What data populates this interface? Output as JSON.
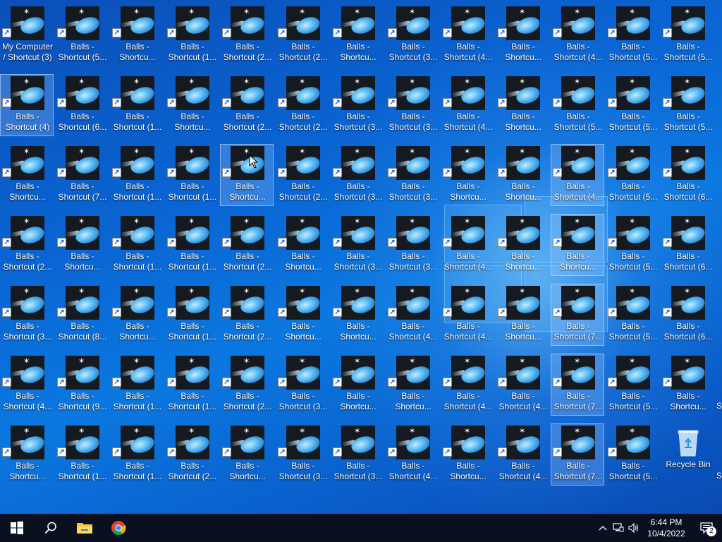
{
  "desktop": {
    "icons": [
      [
        "My Computer / Shortcut (3)",
        "Balls -\nShortcut (5...",
        "Balls -\nShortcu...",
        "Balls -\nShortcut (1...",
        "Balls -\nShortcut (2...",
        "Balls -\nShortcut (2...",
        "Balls -\nShortcu...",
        "Balls -\nShortcut (3...",
        "Balls -\nShortcut (4...",
        "Balls -\nShortcu...",
        "Balls -\nShortcut (4...",
        "Balls -\nShortcut (5...",
        "Balls -\nShortcut (5..."
      ],
      [
        "Balls -\nShortcut (4)",
        "Balls -\nShortcut (6...",
        "Balls -\nShortcut (1...",
        "Balls -\nShortcu...",
        "Balls -\nShortcut (2...",
        "Balls -\nShortcut (2...",
        "Balls -\nShortcut (3...",
        "Balls -\nShortcut (3...",
        "Balls -\nShortcut (4...",
        "Balls -\nShortcu...",
        "Balls -\nShortcut (5...",
        "Balls -\nShortcut (5...",
        "Balls -\nShortcut (5..."
      ],
      [
        "Balls -\nShortcu...",
        "Balls -\nShortcut (7...",
        "Balls -\nShortcut (1...",
        "Balls -\nShortcut (1...",
        "Balls -\nShortcu...",
        "Balls -\nShortcut (2...",
        "Balls -\nShortcut (3...",
        "Balls -\nShortcut (3...",
        "Balls -\nShortcu...",
        "Balls -\nShortcu...",
        "Balls -\nShortcut (4...",
        "Balls -\nShortcut (5...",
        "Balls -\nShortcut (6..."
      ],
      [
        "Balls -\nShortcut (2...",
        "Balls -\nShortcu...",
        "Balls -\nShortcut (1...",
        "Balls -\nShortcut (1...",
        "Balls -\nShortcut (2...",
        "Balls -\nShortcu...",
        "Balls -\nShortcut (3...",
        "Balls -\nShortcut (3...",
        "Balls -\nShortcut (4...",
        "Balls -\nShortcu...",
        "Balls -\nShortcu...",
        "Balls -\nShortcut (5...",
        "Balls -\nShortcut (6..."
      ],
      [
        "Balls -\nShortcut (3...",
        "Balls -\nShortcut (8...",
        "Balls -\nShortcu...",
        "Balls -\nShortcut (1...",
        "Balls -\nShortcut (2...",
        "Balls -\nShortcu...",
        "Balls -\nShortcu...",
        "Balls -\nShortcut (4...",
        "Balls -\nShortcut (4...",
        "Balls -\nShortcu...",
        "Balls -\nShortcut (7...",
        "Balls -\nShortcut (5...",
        "Balls -\nShortcut (6..."
      ],
      [
        "Balls -\nShortcut (4...",
        "Balls -\nShortcut (9...",
        "Balls -\nShortcut (1...",
        "Balls -\nShortcut (1...",
        "Balls -\nShortcut (2...",
        "Balls -\nShortcut (3...",
        "Balls -\nShortcu...",
        "Balls -\nShortcu...",
        "Balls -\nShortcut (4...",
        "Balls -\nShortcut (4...",
        "Balls -\nShortcut (7...",
        "Balls -\nShortcut (5...",
        "Balls -\nShortcu..."
      ],
      [
        "Balls -\nShortcu...",
        "Balls -\nShortcut (1...",
        "Balls -\nShortcut (1...",
        "Balls -\nShortcut (2...",
        "Balls -\nShortcu...",
        "Balls -\nShortcut (3...",
        "Balls -\nShortcut (3...",
        "Balls -\nShortcut (4...",
        "Balls -\nShortcu...",
        "Balls -\nShortcut (4...",
        "Balls -\nShortcut (7...",
        "Balls -\nShortcut (5...",
        "Recycle Bin"
      ]
    ],
    "selected": [
      [
        1,
        0
      ],
      [
        2,
        4
      ],
      [
        2,
        10
      ],
      [
        3,
        10
      ],
      [
        4,
        10
      ],
      [
        5,
        10
      ],
      [
        6,
        10
      ]
    ],
    "edge_fragment": "S"
  },
  "taskbar": {
    "start": "start-icon",
    "search": "search-icon",
    "explorer": "file-explorer-icon",
    "chrome": "chrome-icon",
    "tray": {
      "chevron": "^",
      "network": "network-icon",
      "volume": "volume-icon",
      "time": "6:44 PM",
      "date": "10/4/2022",
      "notifications": "2"
    }
  },
  "colors": {
    "desktop_blue": "#0a66d4",
    "taskbar": "#0a1020",
    "selection": "#a0c8ff"
  }
}
